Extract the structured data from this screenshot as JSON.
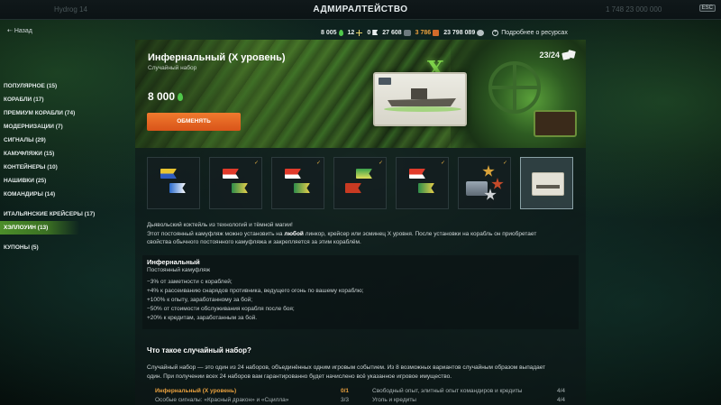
{
  "window": {
    "title": "АДМИРАЛТЕЙСТВО",
    "esc_label": "ESC"
  },
  "nav": {
    "back_label": "Назад"
  },
  "currencies": {
    "doubloons": "8 005",
    "signals": "12",
    "flags": "0",
    "coal": "27 608",
    "steel": "3 786",
    "credits": "23 798 089",
    "more_label": "Подробнее о ресурсах",
    "accent_orange": "#e9a03e",
    "accent_green": "#4fc84a"
  },
  "sidebar": {
    "items": [
      {
        "label": "ПОПУЛЯРНОЕ (15)"
      },
      {
        "label": "КОРАБЛИ (17)"
      },
      {
        "label": "ПРЕМИУМ КОРАБЛИ (74)"
      },
      {
        "label": "МОДЕРНИЗАЦИИ (7)"
      },
      {
        "label": "СИГНАЛЫ (29)"
      },
      {
        "label": "КАМУФЛЯЖИ (15)"
      },
      {
        "label": "КОНТЕЙНЕРЫ (10)"
      },
      {
        "label": "НАШИВКИ (25)"
      },
      {
        "label": "КОМАНДИРЫ (14)"
      }
    ],
    "items2": [
      {
        "label": "ИТАЛЬЯНСКИЕ КРЕЙСЕРЫ (17)"
      },
      {
        "label": "ХЭЛЛОУИН (13)"
      }
    ],
    "items3": [
      {
        "label": "КУПОНЫ (5)"
      }
    ]
  },
  "banner": {
    "title": "Инфернальный (X уровень)",
    "subtitle": "Случайный набор",
    "price": "8 000",
    "button_label": "ОБМЕНЯТЬ",
    "counter": "23/24",
    "emblem": "X"
  },
  "slots": [
    {
      "icon": "flags-icon",
      "checked": true
    },
    {
      "icon": "flags-icon",
      "checked": true
    },
    {
      "icon": "flags-icon",
      "checked": true
    },
    {
      "icon": "flags-icon",
      "checked": true
    },
    {
      "icon": "flags-icon",
      "checked": true
    },
    {
      "icon": "containers-stars-icon",
      "checked": true
    },
    {
      "icon": "camouflage-card-icon",
      "checked": false,
      "selected": true
    }
  ],
  "check_mark": "✓",
  "description": {
    "line1": "Дьявольский коктейль из технологий и тёмной магии!",
    "line2_pre": "Этот постоянный камуфляж можно установить на ",
    "line2_bold": "любой",
    "line2_post": " линкор, крейсер или эсминец X уровня. После установки на корабль он приобретает",
    "line3": "свойства обычного постоянного камуфляжа и закрепляется за этим кораблём."
  },
  "effects": {
    "title": "Инфернальный",
    "subtitle": "Постоянный камуфляж",
    "items": [
      "−3% от заметности с кораблей;",
      "+4% к рассеиванию снарядов противника, ведущего огонь по вашему кораблю;",
      "+100% к опыту, заработанному за бой;",
      "−50% от стоимости обслуживания корабля после боя;",
      "+20% к кредитам, заработанным за бой."
    ]
  },
  "faq": {
    "title": "Что такое случайный набор?",
    "text1": "Случайный набор — это один из 24 наборов, объединённых одним игровым событием. Из 8 возможных вариантов случайным образом выпадает",
    "text2": "один. При получении всех 24 наборов вам гарантированно будет начислено всё указанное игровое имущество."
  },
  "table": {
    "rows": [
      {
        "left": "Инфернальный (X уровень)",
        "left_count": "0/1",
        "right": "Свободный опыт, элитный опыт командиров и кредиты",
        "right_count": "4/4"
      },
      {
        "left": "Особые сигналы: «Красный дракон» и «Сцилла»",
        "left_count": "3/3",
        "right": "Уголь и кредиты",
        "right_count": "4/4"
      }
    ]
  },
  "ghost": {
    "left_text": "Hydrog 14",
    "right_text": "1 748   23 000 000"
  }
}
